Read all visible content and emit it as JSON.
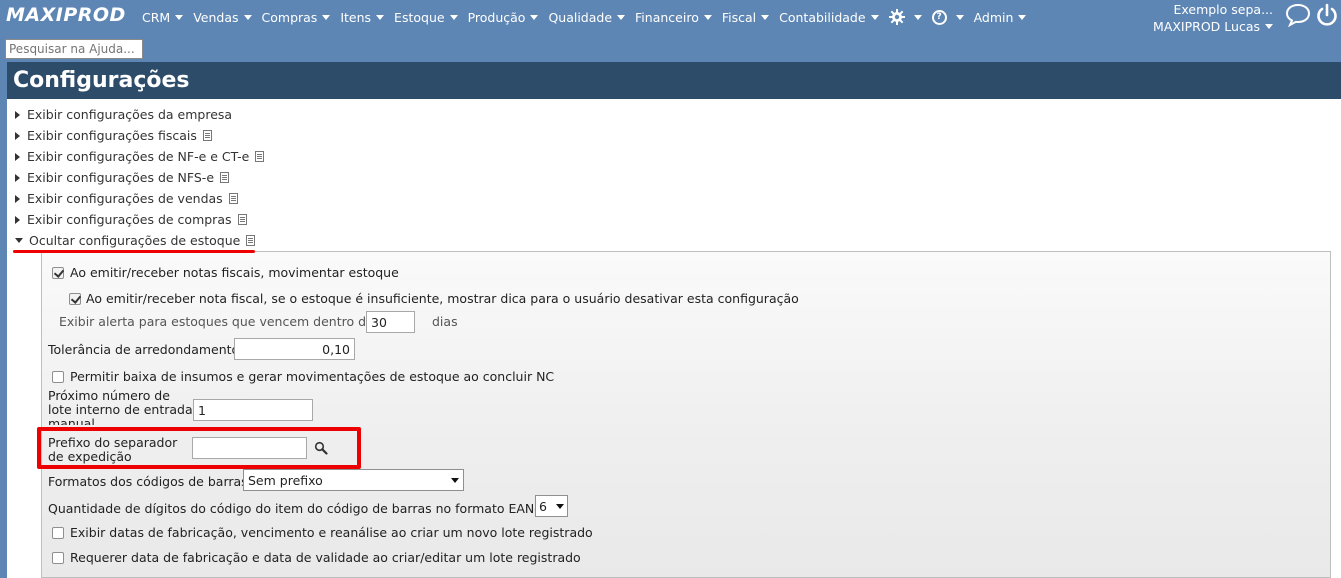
{
  "app": {
    "logo": "MAXIPROD"
  },
  "nav": {
    "items": [
      "CRM",
      "Vendas",
      "Compras",
      "Itens",
      "Estoque",
      "Produção",
      "Qualidade",
      "Financeiro",
      "Fiscal",
      "Contabilidade"
    ],
    "admin_label": "Admin"
  },
  "user": {
    "company": "Exemplo sepa...",
    "name": "MAXIPROD Lucas"
  },
  "search": {
    "placeholder": "Pesquisar na Ajuda..."
  },
  "page": {
    "title": "Configurações"
  },
  "sections": [
    {
      "label": "Exibir configurações da empresa",
      "doc": false
    },
    {
      "label": "Exibir configurações fiscais",
      "doc": true
    },
    {
      "label": "Exibir configurações de NF-e e CT-e",
      "doc": true
    },
    {
      "label": "Exibir configurações de NFS-e",
      "doc": true
    },
    {
      "label": "Exibir configurações de vendas",
      "doc": true
    },
    {
      "label": "Exibir configurações de compras",
      "doc": true
    },
    {
      "label": "Ocultar configurações de estoque",
      "doc": true,
      "expanded": true
    }
  ],
  "stock": {
    "move_stock_label": "Ao emitir/receber notas fiscais, movimentar estoque",
    "move_stock_checked": true,
    "insufficient_tip_label": "Ao emitir/receber nota fiscal, se o estoque é insuficiente, mostrar dica para o usuário desativar esta configuração",
    "insufficient_tip_checked": true,
    "expiry_alert_label": "Exibir alerta para estoques que vencem dentro de",
    "expiry_alert_value": "30",
    "expiry_alert_unit": "dias",
    "rounding_label": "Tolerância de arredondamento",
    "rounding_value": "0,10",
    "allow_consumption_label": "Permitir baixa de insumos e gerar movimentações de estoque ao concluir NC",
    "allow_consumption_checked": false,
    "next_lot_label_1": "Próximo número de",
    "next_lot_label_2": "lote interno de entrada",
    "next_lot_label_3": "manual",
    "next_lot_value": "1",
    "separator_prefix_label_1": "Prefixo do separador",
    "separator_prefix_label_2": "de expedição",
    "separator_prefix_value": "",
    "barcode_formats_label": "Formatos dos códigos de barras",
    "barcode_formats_value": "Sem prefixo",
    "ean13_digits_label": "Quantidade de dígitos do código do item do código de barras no formato EAN-13",
    "ean13_digits_value": "6",
    "show_dates_label": "Exibir datas de fabricação, vencimento e reanálise ao criar um novo lote registrado",
    "show_dates_checked": false,
    "require_dates_label": "Requerer data de fabricação e data de validade ao criar/editar um lote registrado",
    "require_dates_checked": false
  },
  "colors": {
    "nav_bg": "#5e86b5",
    "title_bg": "#2d4c69",
    "highlight": "#e00000"
  }
}
